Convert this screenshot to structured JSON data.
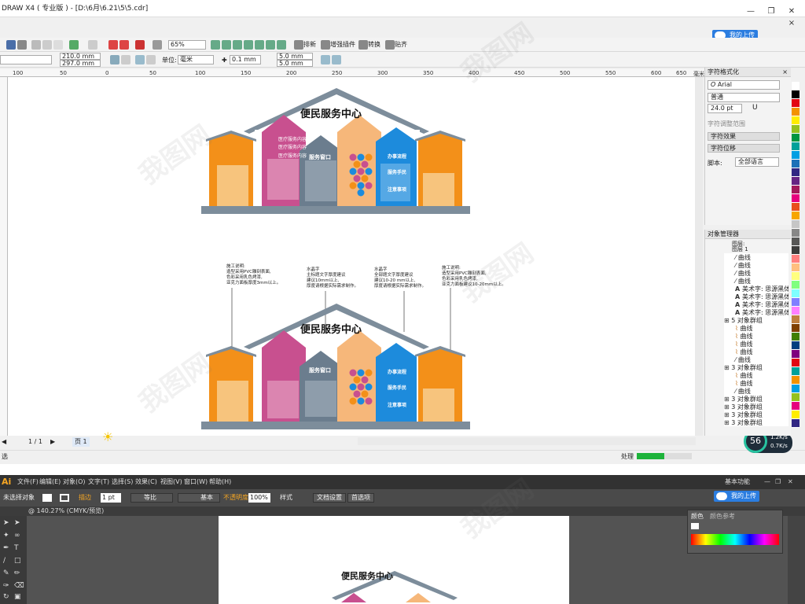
{
  "corel": {
    "title": "DRAW X4 ( 专业版 ) - [D:\\6月\\6.21\\5\\5.cdr]",
    "zoom": "65%",
    "std_buttons": [
      "排新",
      "增强插件",
      "转换",
      "贴齐"
    ],
    "width": "210.0 mm",
    "height": "297.0 mm",
    "unit_label": "单位:",
    "unit": "毫米",
    "nudge": "0.1 mm",
    "dup_x": "5.0 mm",
    "dup_y": "5.0 mm",
    "cloud_btn": "我的上传",
    "ruler_labels": [
      "100",
      "50",
      "0",
      "50",
      "100",
      "150",
      "200",
      "250",
      "300",
      "350",
      "400",
      "450",
      "500",
      "550",
      "600",
      "650",
      "毫米"
    ],
    "page_nav": "1 / 1",
    "page_tab": "页 1",
    "status_left": "选",
    "status_right": "处理",
    "progress_pct": "56",
    "speed_up": "1.2",
    "speed_unit_up": "K/s",
    "speed_down": "0.7",
    "speed_unit_down": "K/s"
  },
  "char_panel": {
    "title": "字符格式化",
    "font": "Arial",
    "style": "普通",
    "size": "24.0 pt",
    "adjust_label": "字符调整范围",
    "effects": "字符效果",
    "shift": "字符位移",
    "script_label": "脚本:",
    "script_value": "全部语言"
  },
  "obj_panel": {
    "title": "对象管理器",
    "layer_label": "图层:",
    "layer_name": "图层 1",
    "rows": [
      {
        "indent": 14,
        "icon": "curve",
        "label": "曲线"
      },
      {
        "indent": 14,
        "icon": "curve",
        "label": "曲线"
      },
      {
        "indent": 14,
        "icon": "curve",
        "label": "曲线"
      },
      {
        "indent": 14,
        "icon": "curve",
        "label": "曲线"
      },
      {
        "indent": 14,
        "icon": "text",
        "label": "美术字: 思源黑体 C"
      },
      {
        "indent": 14,
        "icon": "text",
        "label": "美术字: 思源黑体 C"
      },
      {
        "indent": 14,
        "icon": "text",
        "label": "美术字: 思源黑体 C"
      },
      {
        "indent": 14,
        "icon": "text",
        "label": "美术字: 思源黑体 C"
      },
      {
        "indent": 0,
        "icon": "group",
        "label": "5 对象群组"
      },
      {
        "indent": 14,
        "icon": "curve2",
        "label": "曲线"
      },
      {
        "indent": 14,
        "icon": "curve2",
        "label": "曲线"
      },
      {
        "indent": 14,
        "icon": "curve2",
        "label": "曲线"
      },
      {
        "indent": 14,
        "icon": "curve2",
        "label": "曲线"
      },
      {
        "indent": 14,
        "icon": "curve",
        "label": "曲线"
      },
      {
        "indent": 0,
        "icon": "group",
        "label": "3 对象群组"
      },
      {
        "indent": 14,
        "icon": "curve2",
        "label": "曲线"
      },
      {
        "indent": 14,
        "icon": "curve2",
        "label": "曲线"
      },
      {
        "indent": 14,
        "icon": "curve",
        "label": "曲线"
      },
      {
        "indent": 0,
        "icon": "group",
        "label": "3 对象群组"
      },
      {
        "indent": 0,
        "icon": "group",
        "label": "3 对象群组"
      },
      {
        "indent": 0,
        "icon": "group",
        "label": "3 对象群组"
      },
      {
        "indent": 0,
        "icon": "group",
        "label": "3 对象群组"
      }
    ]
  },
  "design": {
    "title": "便民服务中心",
    "window_label": "服务窗口",
    "pillar_blue": [
      "办事流程",
      "服务手民",
      "注意事项"
    ],
    "pillar_pink": [
      "医疗服务内容",
      "医疗服务内容",
      "医疗服务内容"
    ],
    "notes": [
      "施工说明:\n造型采用PVC雕刻表面,\n色彩采用乳色烤漆,\n亚克力面板厚度3mm以上。",
      "水晶字\n主标题文字厚度建议\n建议10mm以上,\n厚度请根据实际需求制作。",
      "水晶字\n全部题文字厚度建议\n建议10-20 mm以上,\n厚度请根据实际需求制作。",
      "施工说明:\n造型采用PVC雕刻表面,\n色彩采用乳色烤漆,\n亚克力面板建议10-20mm以上。"
    ]
  },
  "ai": {
    "logo": "Ai",
    "menus": [
      "文件(F)",
      "编辑(E)",
      "对象(O)",
      "文字(T)",
      "选择(S)",
      "效果(C)",
      "视图(V)",
      "窗口(W)",
      "帮助(H)"
    ],
    "workspace": "基本功能",
    "no_selection": "未选择对象",
    "stroke_label": "描边",
    "stroke_value": "1 pt",
    "line1": "等比",
    "line2": "基本",
    "opacity_label": "不透明度",
    "opacity_value": "100%",
    "style_label": "样式",
    "doc_setup": "文档设置",
    "preferences": "首选项",
    "doc_tab": "@ 140.27% (CMYK/预览)",
    "cloud_btn": "我的上传",
    "color_tab": "颜色",
    "color_guide_tab": "颜色参考"
  },
  "watermark": "我图网",
  "colors": {
    "orange": "#f39019",
    "orange_light": "#f7c47d",
    "pink": "#c8508f",
    "slate": "#6b7d8e",
    "blue": "#1d8bdc",
    "peach": "#f6b77a",
    "roof": "#7d8d9b"
  }
}
